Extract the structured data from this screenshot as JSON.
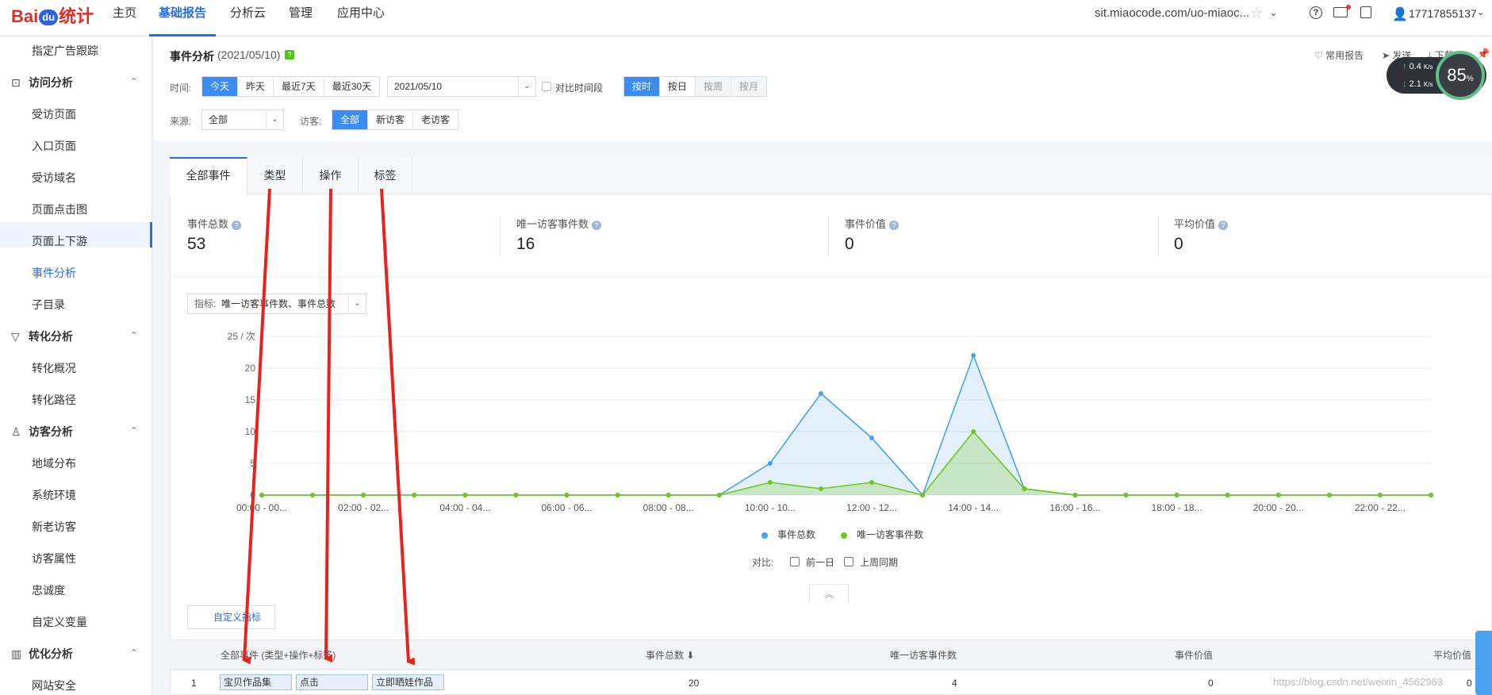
{
  "topnav": {
    "logo_bai": "Bai",
    "logo_du": "du",
    "logo_tongji": "统计",
    "items": [
      {
        "label": "主页"
      },
      {
        "label": "基础报告"
      },
      {
        "label": "分析云"
      },
      {
        "label": "管理"
      },
      {
        "label": "应用中心"
      }
    ],
    "site": "sit.miaocode.com/uo-miaoc...",
    "user": "17717855137"
  },
  "sidebar": {
    "items": [
      {
        "label": "指定广告跟踪"
      },
      {
        "label": "访问分析"
      },
      {
        "label": "受访页面"
      },
      {
        "label": "入口页面"
      },
      {
        "label": "受访域名"
      },
      {
        "label": "页面点击图"
      },
      {
        "label": "页面上下游"
      },
      {
        "label": "事件分析"
      },
      {
        "label": "子目录"
      },
      {
        "label": "转化分析"
      },
      {
        "label": "转化概况"
      },
      {
        "label": "转化路径"
      },
      {
        "label": "访客分析"
      },
      {
        "label": "地域分布"
      },
      {
        "label": "系统环境"
      },
      {
        "label": "新老访客"
      },
      {
        "label": "访客属性"
      },
      {
        "label": "忠诚度"
      },
      {
        "label": "自定义变量"
      },
      {
        "label": "优化分析"
      },
      {
        "label": "网站安全"
      }
    ]
  },
  "page": {
    "title": "事件分析",
    "date": "(2021/05/10)",
    "help": "?",
    "fav_report": "常用报告",
    "send": "发送",
    "download": "下载"
  },
  "filters": {
    "time_label": "时间:",
    "time_options": [
      "今天",
      "昨天",
      "最近7天",
      "最近30天"
    ],
    "date_value": "2021/05/10",
    "compare_period": "对比时间段",
    "granularity": [
      "按时",
      "按日",
      "按周",
      "按月"
    ],
    "source_label": "来源:",
    "source_value": "全部",
    "visitor_label": "访客:",
    "visitor_options": [
      "全部",
      "新访客",
      "老访客"
    ]
  },
  "speed_widget": {
    "up": "0.4",
    "down": "2.1",
    "unit": "K/s",
    "cpu": "85"
  },
  "tabs": [
    {
      "label": "全部事件"
    },
    {
      "label": "类型"
    },
    {
      "label": "操作"
    },
    {
      "label": "标签"
    }
  ],
  "kpis": [
    {
      "label": "事件总数",
      "value": "53"
    },
    {
      "label": "唯一访客事件数",
      "value": "16"
    },
    {
      "label": "事件价值",
      "value": "0"
    },
    {
      "label": "平均价值",
      "value": "0"
    }
  ],
  "metric_select": {
    "label": "指标:",
    "value": "唯一访客事件数、事件总数"
  },
  "chart_data": {
    "type": "area",
    "ylabel": "25 / 次",
    "ylim": [
      0,
      25
    ],
    "yticks": [
      0,
      5,
      10,
      15,
      20
    ],
    "x_tick_labels": [
      "00:00 - 00...",
      "02:00 - 02...",
      "04:00 - 04...",
      "06:00 - 06...",
      "08:00 - 08...",
      "10:00 - 10...",
      "12:00 - 12...",
      "14:00 - 14...",
      "16:00 - 16...",
      "18:00 - 18...",
      "20:00 - 20...",
      "22:00 - 22..."
    ],
    "series": [
      {
        "name": "事件总数",
        "color": "#4aa1f0",
        "values": [
          0,
          0,
          0,
          0,
          0,
          0,
          0,
          0,
          0,
          0,
          5,
          16,
          9,
          0,
          22,
          1,
          0,
          0,
          0,
          0,
          0,
          0,
          0,
          0
        ]
      },
      {
        "name": "唯一访客事件数",
        "color": "#6ec71e",
        "values": [
          0,
          0,
          0,
          0,
          0,
          0,
          0,
          0,
          0,
          0,
          2,
          1,
          2,
          0,
          10,
          1,
          0,
          0,
          0,
          0,
          0,
          0,
          0,
          0
        ]
      }
    ],
    "grid": true,
    "legend": "bottom"
  },
  "compare": {
    "label": "对比:",
    "options": [
      "前一日",
      "上周同期"
    ]
  },
  "custom_metric": "自定义指标",
  "table": {
    "headers": [
      "全部事件 (类型+操作+标签)",
      "事件总数",
      "唯一访客事件数",
      "事件价值",
      "平均价值"
    ],
    "rows": [
      {
        "index": "1",
        "type": "宝贝作品集",
        "action": "点击",
        "label": "立即晒娃作品",
        "total": "20",
        "unique": "4",
        "value": "0",
        "avg": "0"
      }
    ]
  },
  "watermark": "https://blog.csdn.net/weixin_4562963"
}
